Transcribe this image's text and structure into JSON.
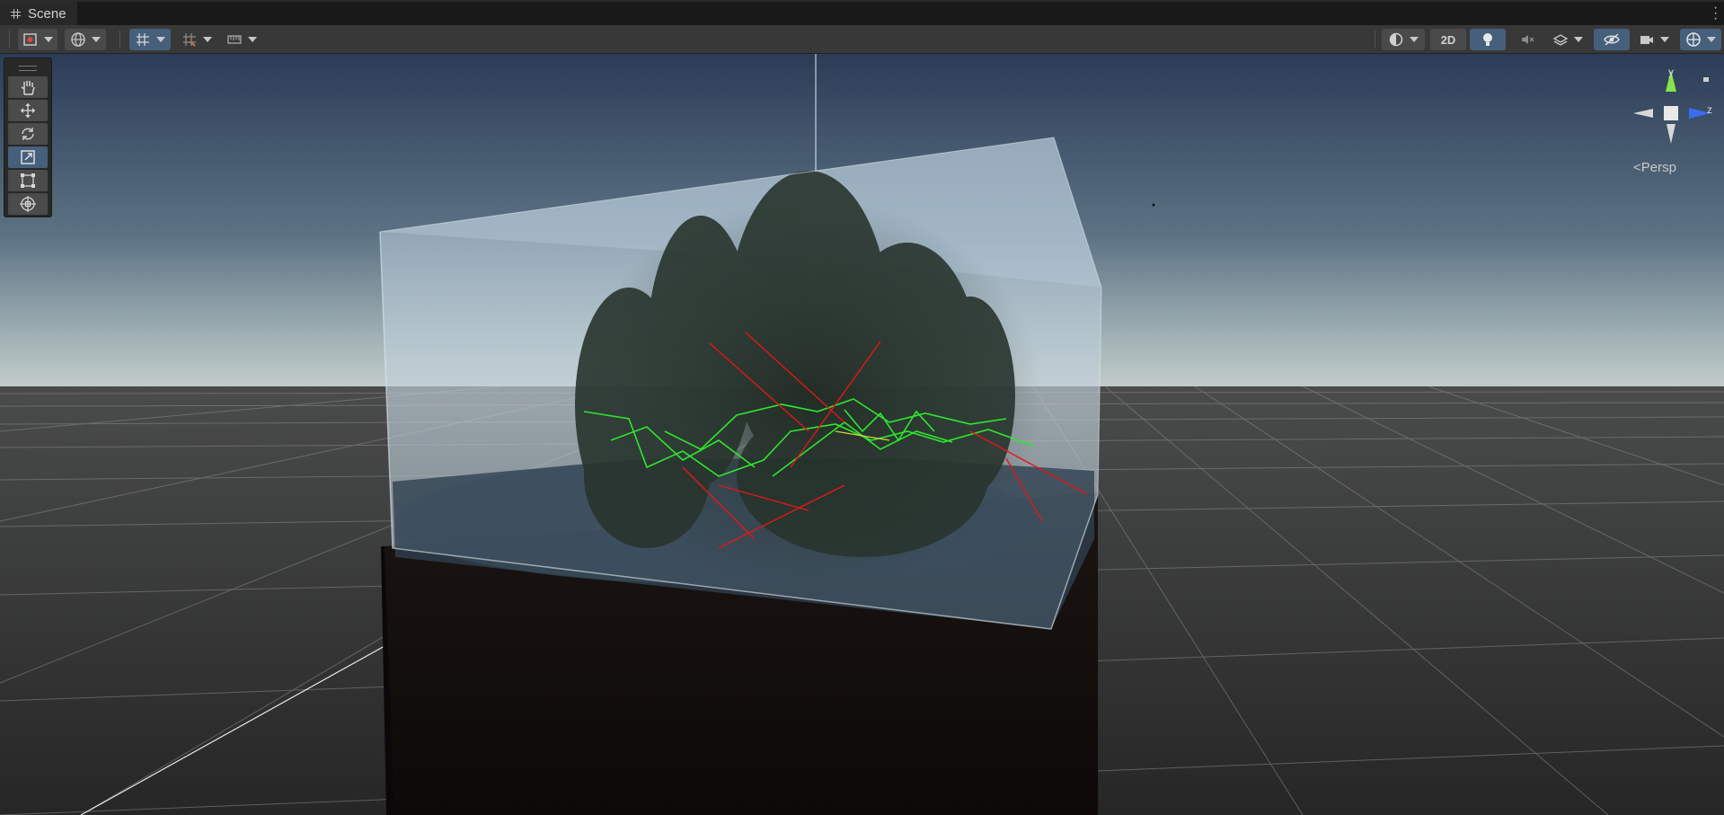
{
  "tab": {
    "title": "Scene"
  },
  "toolbar": {
    "left": [
      {
        "name": "tool-handle-toggle",
        "icon": "gizmo-handle-icon"
      },
      {
        "name": "pivot-global-toggle",
        "icon": "globe-icon"
      },
      {
        "name": "grid-snapping-toggle",
        "icon": "grid-snap-icon",
        "active": true
      },
      {
        "name": "increment-snapping-toggle",
        "icon": "increment-snap-icon"
      },
      {
        "name": "ruler-toggle",
        "icon": "ruler-icon"
      }
    ],
    "right": {
      "draw_mode": "shaded-sphere-icon",
      "mode_2d_label": "2D",
      "lighting": "lightbulb-icon",
      "audio": "audio-mute-icon",
      "effects": "effects-stack-icon",
      "visibility": "hidden-eye-icon",
      "camera": "camera-icon",
      "gizmos": "gizmo-globe-icon"
    }
  },
  "tools": [
    {
      "name": "hand-tool",
      "icon": "hand-icon"
    },
    {
      "name": "move-tool",
      "icon": "move-arrows-icon"
    },
    {
      "name": "rotate-tool",
      "icon": "rotate-icon"
    },
    {
      "name": "scale-tool",
      "icon": "scale-icon",
      "active": true
    },
    {
      "name": "rect-tool",
      "icon": "rect-transform-icon"
    },
    {
      "name": "transform-tool",
      "icon": "transform-all-icon"
    }
  ],
  "gizmo": {
    "axes": {
      "y": "y",
      "z": "z"
    },
    "projection_label": "<Persp",
    "colors": {
      "y": "#86e34a",
      "z": "#3a6cf0",
      "x_neg": "#d8d8d8"
    }
  },
  "colors": {
    "accent_active": "#46607c",
    "sky_top": "#2d3f5a",
    "horizon": "#9eb0b6",
    "ground": "#3a3a3a",
    "glass": "#b8ccdc",
    "plants": "#2f3b33",
    "path_green": "#29e629",
    "path_red": "#e61a1a"
  }
}
